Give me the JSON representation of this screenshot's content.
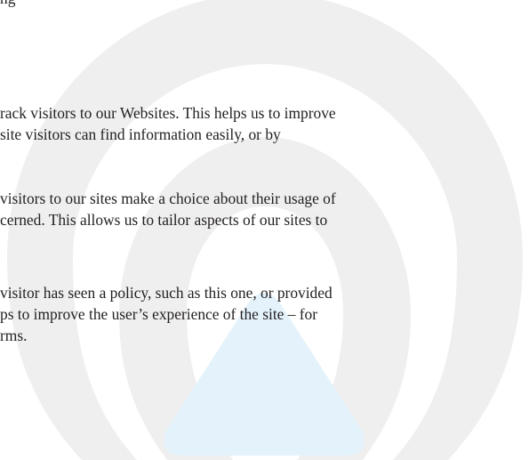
{
  "top_fragment": "ng",
  "paragraphs": [
    {
      "lines": [
        "rack visitors to our Websites. This helps us to improve",
        "site visitors can find information easily, or by"
      ]
    },
    {
      "lines": [
        "visitors to our sites make a choice about their usage of",
        "cerned. This allows us to tailor aspects of our sites to"
      ]
    },
    {
      "lines": [
        "visitor has seen a policy, such as this one, or provided",
        "ps to improve the user’s experience of the site – for",
        "rms."
      ]
    }
  ],
  "watermark": {
    "icon": "signal-arch-logo",
    "arc_color": "#efefef",
    "triangle_color": "#e4f3fb"
  }
}
